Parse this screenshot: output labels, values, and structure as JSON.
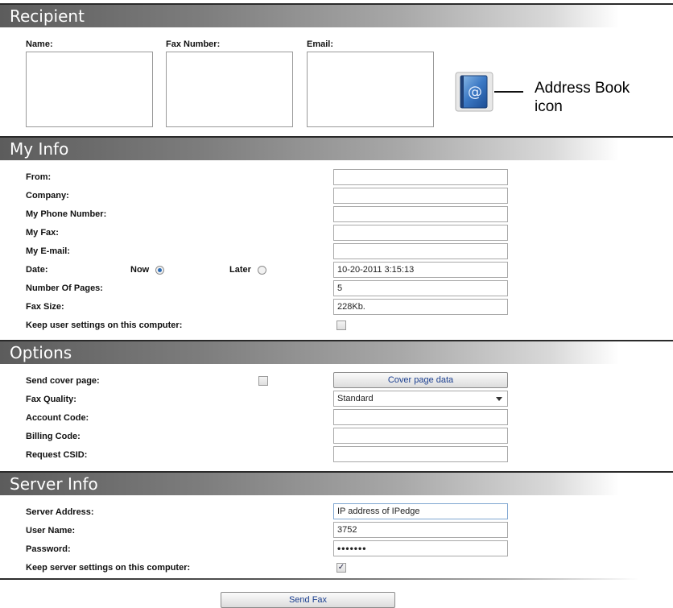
{
  "recipient": {
    "header": "Recipient",
    "name_label": "Name:",
    "fax_label": "Fax Number:",
    "email_label": "Email:",
    "callout_line1": "Address Book",
    "callout_line2": "icon"
  },
  "my_info": {
    "header": "My Info",
    "from_label": "From:",
    "company_label": "Company:",
    "phone_label": "My Phone Number:",
    "fax_label": "My Fax:",
    "email_label": "My E-mail:",
    "date_label": "Date:",
    "now_label": "Now",
    "later_label": "Later",
    "date_value": "10-20-2011 3:15:13",
    "pages_label": "Number Of Pages:",
    "pages_value": "5",
    "size_label": "Fax Size:",
    "size_value": "228Kb.",
    "keep_label": "Keep user settings on this computer:"
  },
  "options": {
    "header": "Options",
    "cover_label": "Send cover page:",
    "cover_button": "Cover page data",
    "quality_label": "Fax Quality:",
    "quality_value": "Standard",
    "account_label": "Account Code:",
    "billing_label": "Billing Code:",
    "csid_label": "Request CSID:"
  },
  "server_info": {
    "header": "Server Info",
    "address_label": "Server Address:",
    "address_value": "IP address of IPedge",
    "user_label": "User Name:",
    "user_value": "3752",
    "password_label": "Password:",
    "password_value": "•••••••",
    "keep_label": "Keep server settings on this computer:",
    "keep_checked": "✓"
  },
  "send_button": "Send Fax",
  "icons": [
    "address-book-icon",
    "radio-icon",
    "checkbox-icon",
    "dropdown-arrow-icon"
  ],
  "colors": {
    "header_dark": "#5c5c5c",
    "link_blue": "#1a3e8f",
    "radio_blue": "#2e6db5"
  }
}
